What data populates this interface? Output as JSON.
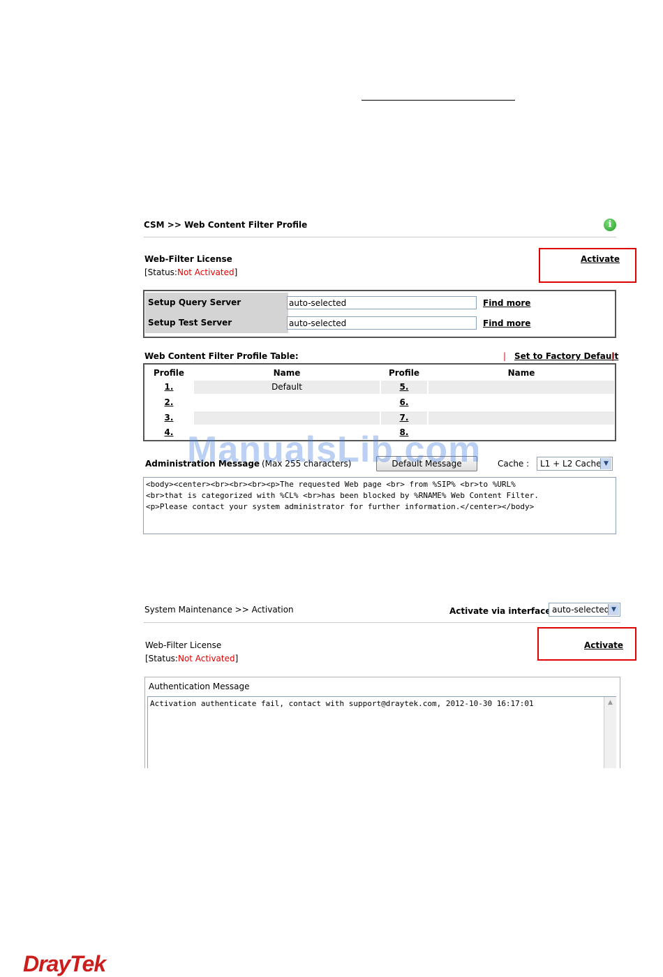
{
  "csm": {
    "breadcrumb": "CSM >> Web Content Filter Profile",
    "license_title": "Web-Filter License",
    "status_prefix": "[Status:",
    "status_value": "Not Activated",
    "status_suffix": "]",
    "activate_label": "Activate",
    "query_server_label": "Setup Query Server",
    "query_server_value": "auto-selected",
    "test_server_label": "Setup Test Server",
    "test_server_value": "auto-selected",
    "find_more_label": "Find more",
    "table_title": "Web Content Filter Profile Table:",
    "factory_default_label": "Set to Factory Default",
    "columns": [
      "Profile",
      "Name",
      "Profile",
      "Name"
    ],
    "rows": [
      {
        "p1": "1.",
        "n1": "Default",
        "p2": "5.",
        "n2": ""
      },
      {
        "p1": "2.",
        "n1": "",
        "p2": "6.",
        "n2": ""
      },
      {
        "p1": "3.",
        "n1": "",
        "p2": "7.",
        "n2": ""
      },
      {
        "p1": "4.",
        "n1": "",
        "p2": "8.",
        "n2": ""
      }
    ],
    "admin_label": "Administration Message",
    "admin_hint": "(Max 255 characters)",
    "default_message_button": "Default Message",
    "cache_label": "Cache :",
    "cache_value": "L1 + L2 Cache",
    "admin_message": "<body><center><br><br><br><p>The requested Web page <br> from %SIP% <br>to %URL%\n<br>that is categorized with %CL% <br>has been blocked by %RNAME% Web Content Filter.\n<p>Please contact your system administrator for further information.</center></body>"
  },
  "watermark": "ManualsLib.com",
  "maintenance": {
    "breadcrumb": "System Maintenance >> Activation",
    "interface_label": "Activate via interface :",
    "interface_value": "auto-selected",
    "license_title": "Web-Filter License",
    "status_prefix": "[Status:",
    "status_value": "Not Activated",
    "status_suffix": "]",
    "activate_label": "Activate",
    "auth_title": "Authentication Message",
    "auth_message": "Activation authenticate fail, contact with support@draytek.com, 2012-10-30 16:17:01"
  },
  "brand": {
    "logo_text": "DrayTek",
    "accent_color": "#e00000"
  },
  "icons": [
    "info-icon",
    "chevron-down-icon",
    "scroll-up-icon"
  ]
}
